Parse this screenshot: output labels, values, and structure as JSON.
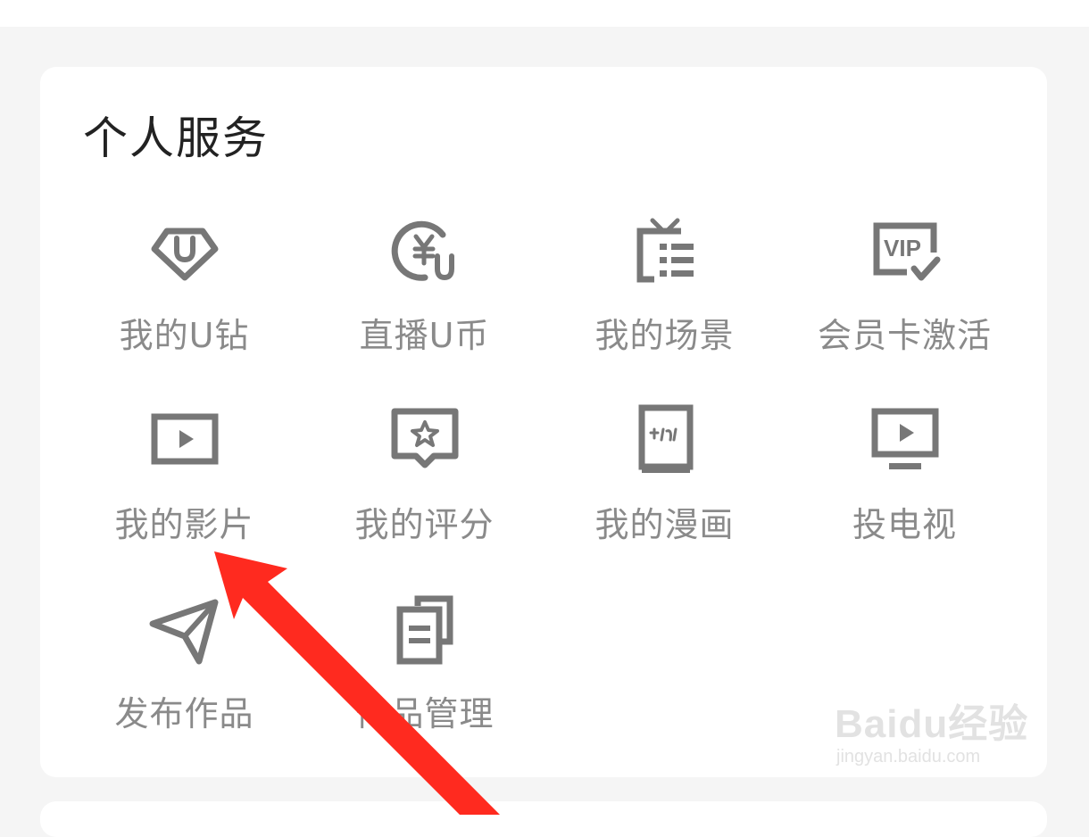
{
  "section": {
    "title": "个人服务"
  },
  "items": [
    {
      "label": "我的U钻",
      "icon": "u-diamond-icon"
    },
    {
      "label": "直播U币",
      "icon": "yuan-coin-icon"
    },
    {
      "label": "我的场景",
      "icon": "tv-list-icon"
    },
    {
      "label": "会员卡激活",
      "icon": "vip-card-icon"
    },
    {
      "label": "我的影片",
      "icon": "play-box-icon"
    },
    {
      "label": "我的评分",
      "icon": "star-bubble-icon"
    },
    {
      "label": "我的漫画",
      "icon": "comic-book-icon"
    },
    {
      "label": "投电视",
      "icon": "tv-play-icon"
    },
    {
      "label": "发布作品",
      "icon": "paper-plane-icon"
    },
    {
      "label": "作品管理",
      "icon": "documents-icon"
    }
  ],
  "watermark": {
    "logo": "Baidu经验",
    "url": "jingyan.baidu.com"
  },
  "annotation": {
    "color": "#ff2a1f"
  }
}
